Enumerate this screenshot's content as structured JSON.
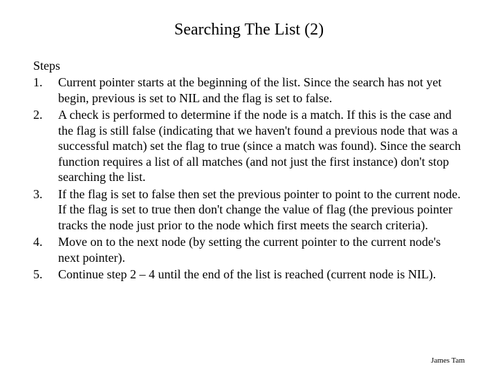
{
  "title": "Searching The List (2)",
  "steps_header": "Steps",
  "steps": [
    {
      "num": "1.",
      "text": "Current pointer starts at the beginning of the list.  Since the search has not yet begin, previous is set to NIL and the flag is set to false."
    },
    {
      "num": "2.",
      "text": "A check is performed to determine if the node is a match.  If this is the case and the flag is still false (indicating that we haven't found a previous node that was a successful match) set the flag to true (since a match was found).  Since the search function requires a list of all matches (and not just the first instance) don't stop searching the list."
    },
    {
      "num": "3.",
      "text": "If the flag is set to false then set the previous pointer to point to the current node.  If the flag is set to true then don't change the value of flag (the previous pointer tracks the node just prior to the node which first meets the search criteria)."
    },
    {
      "num": "4.",
      "text": "Move on to the next node (by setting the current pointer to the current node's next pointer)."
    },
    {
      "num": "5.",
      "text": "Continue step 2 – 4 until the end of the list is reached (current node is NIL)."
    }
  ],
  "footer": "James Tam"
}
